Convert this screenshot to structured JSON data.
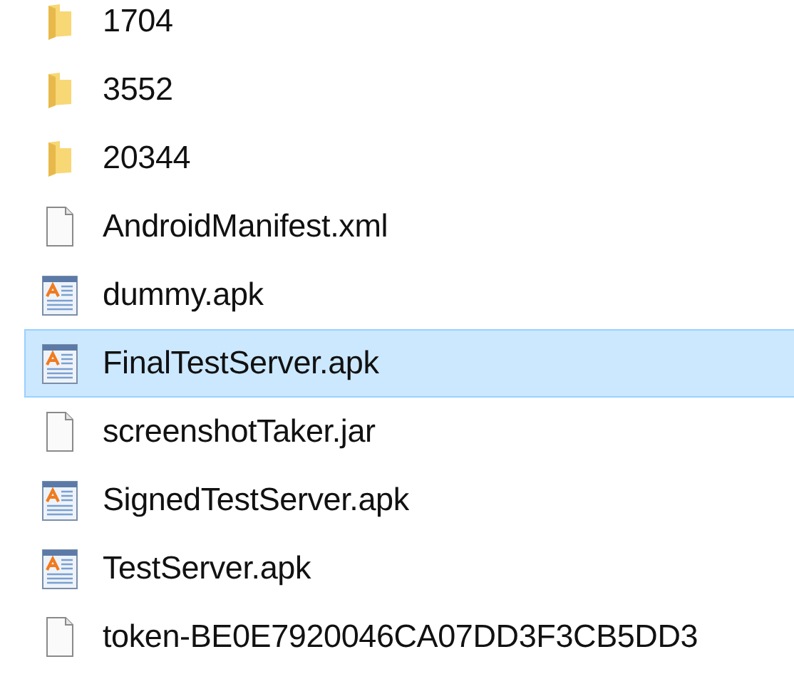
{
  "files": [
    {
      "name": "1704",
      "kind": "folder",
      "selected": false
    },
    {
      "name": "3552",
      "kind": "folder",
      "selected": false
    },
    {
      "name": "20344",
      "kind": "folder",
      "selected": false
    },
    {
      "name": "AndroidManifest.xml",
      "kind": "file",
      "selected": false
    },
    {
      "name": "dummy.apk",
      "kind": "apk",
      "selected": false
    },
    {
      "name": "FinalTestServer.apk",
      "kind": "apk",
      "selected": true
    },
    {
      "name": "screenshotTaker.jar",
      "kind": "file",
      "selected": false
    },
    {
      "name": "SignedTestServer.apk",
      "kind": "apk",
      "selected": false
    },
    {
      "name": "TestServer.apk",
      "kind": "apk",
      "selected": false
    },
    {
      "name": "token-BE0E7920046CA07DD3F3CB5DD3",
      "kind": "file",
      "selected": false
    }
  ]
}
